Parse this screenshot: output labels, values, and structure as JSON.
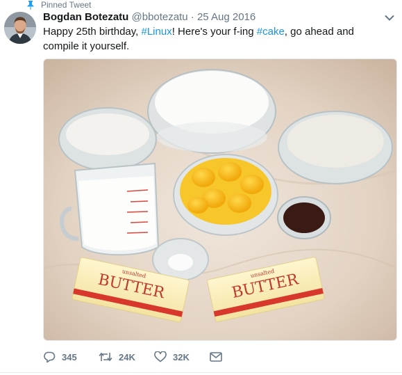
{
  "context": {
    "label": "Pinned Tweet",
    "icon": "pin-icon"
  },
  "author": {
    "name": "Bogdan Botezatu",
    "handle": "@bbotezatu",
    "separator": "·",
    "date": "25 Aug 2016"
  },
  "tweet": {
    "text_1": "Happy 25th birthday, ",
    "tag_linux": "#Linux",
    "text_2": "! Here's your f-ing ",
    "tag_cake": "#cake",
    "text_3": ", go ahead and compile it yourself."
  },
  "media": {
    "butter_top": "unsalted",
    "butter_word": "BUTTER"
  },
  "actions": {
    "reply_count": "345",
    "retweet_count": "24K",
    "like_count": "32K"
  },
  "colors": {
    "link": "#1b95e0",
    "muted": "#657786",
    "text": "#14171a"
  }
}
